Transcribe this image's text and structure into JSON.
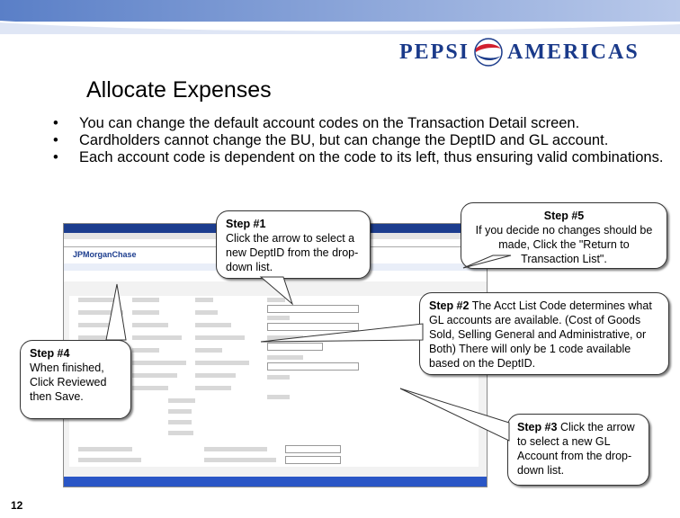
{
  "logo": {
    "left_text": "PEPSI",
    "right_text": "AMERICAS"
  },
  "slide": {
    "title": "Allocate Expenses",
    "bullets": [
      "You can change the default account codes on the Transaction Detail screen.",
      "Cardholders cannot change the BU, but can change the DeptID and GL account.",
      "Each account code is dependent on the code to its left, thus ensuring valid combinations."
    ],
    "page_number": "12"
  },
  "screenshot": {
    "brand": "JPMorganChase"
  },
  "callouts": {
    "step1": {
      "label": "Step #1",
      "text": "Click the arrow to select a new DeptID from the drop-down list."
    },
    "step5": {
      "label": "Step #5",
      "text": "If you decide no changes should be made, Click the \"Return to Transaction List\"."
    },
    "step2": {
      "label": "Step #2",
      "text": " The Acct List Code determines what GL accounts are available. (Cost of Goods Sold, Selling General and Administrative, or Both)  There will only be 1 code available based on the DeptID."
    },
    "step4": {
      "label": "Step #4",
      "text": "When finished, Click Reviewed then Save."
    },
    "step3": {
      "label": "Step #3",
      "text": " Click the arrow to select a new GL Account from the drop-down list."
    }
  },
  "colors": {
    "logo_blue": "#1a3a8a",
    "logo_red": "#d2202f",
    "bar_blue": "#3b64b8"
  }
}
